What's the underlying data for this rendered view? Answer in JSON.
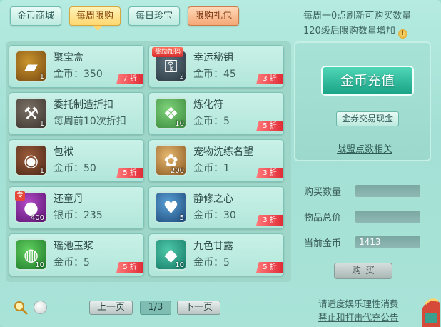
{
  "tabs": [
    {
      "label": "金币商城"
    },
    {
      "label": "每周限购"
    },
    {
      "label": "每日珍宝"
    },
    {
      "label": "限购礼包"
    }
  ],
  "refresh_note": {
    "line1": "每周一0点刷新可购买数量",
    "line2": "120级后限购数量增加",
    "tip_icon": "!"
  },
  "items": [
    {
      "name": "聚宝盒",
      "price": "金币：350",
      "count": "1",
      "discount": "7 折",
      "icon": "treasure-box-icon",
      "glyph": "▰"
    },
    {
      "name": "幸运秘钥",
      "price": "金币：45",
      "count": "2",
      "discount": "3 折",
      "icon": "key-icon",
      "glyph": "⚿",
      "badge": "奖励加码"
    },
    {
      "name": "委托制造折扣",
      "price": "每周前10次折扣",
      "count": "1",
      "discount": "",
      "icon": "hammer-icon",
      "glyph": "⚒"
    },
    {
      "name": "炼化符",
      "price": "金币：5",
      "count": "10",
      "discount": "5 折",
      "icon": "talisman-icon",
      "glyph": "❖"
    },
    {
      "name": "包袱",
      "price": "金币：50",
      "count": "1",
      "discount": "5 折",
      "icon": "bag-icon",
      "glyph": "◉"
    },
    {
      "name": "宠物洗练名望",
      "price": "金币：1",
      "count": "200",
      "discount": "3 折",
      "icon": "pet-paw-icon",
      "glyph": "✿"
    },
    {
      "name": "还童丹",
      "price": "银币：235",
      "count": "400",
      "discount": "",
      "icon": "pill-icon",
      "glyph": "●",
      "badge_zhuan": "专"
    },
    {
      "name": "静修之心",
      "price": "金币：30",
      "count": "5",
      "discount": "3 折",
      "icon": "heart-icon",
      "glyph": "♥"
    },
    {
      "name": "瑶池玉浆",
      "price": "金币：5",
      "count": "10",
      "discount": "5 折",
      "icon": "jade-potion-icon",
      "glyph": "◍"
    },
    {
      "name": "九色甘露",
      "price": "金币：5",
      "count": "10",
      "discount": "5 折",
      "icon": "dew-icon",
      "glyph": "◆"
    }
  ],
  "right": {
    "recharge_label": "金币充值",
    "coupon_label": "金券交易现金",
    "alliance_link": "战盟点数相关",
    "qty_label": "购买数量",
    "qty_value": "",
    "total_label": "物品总价",
    "total_value": "",
    "coins_label": "当前金币",
    "coins_value": "1413",
    "buy_label": "购买"
  },
  "pager": {
    "prev_label": "上一页",
    "page_indicator": "1/3",
    "next_label": "下一页"
  },
  "notices": {
    "line1": "请适度娱乐理性消费",
    "line2": "禁止和打击代充公告"
  }
}
